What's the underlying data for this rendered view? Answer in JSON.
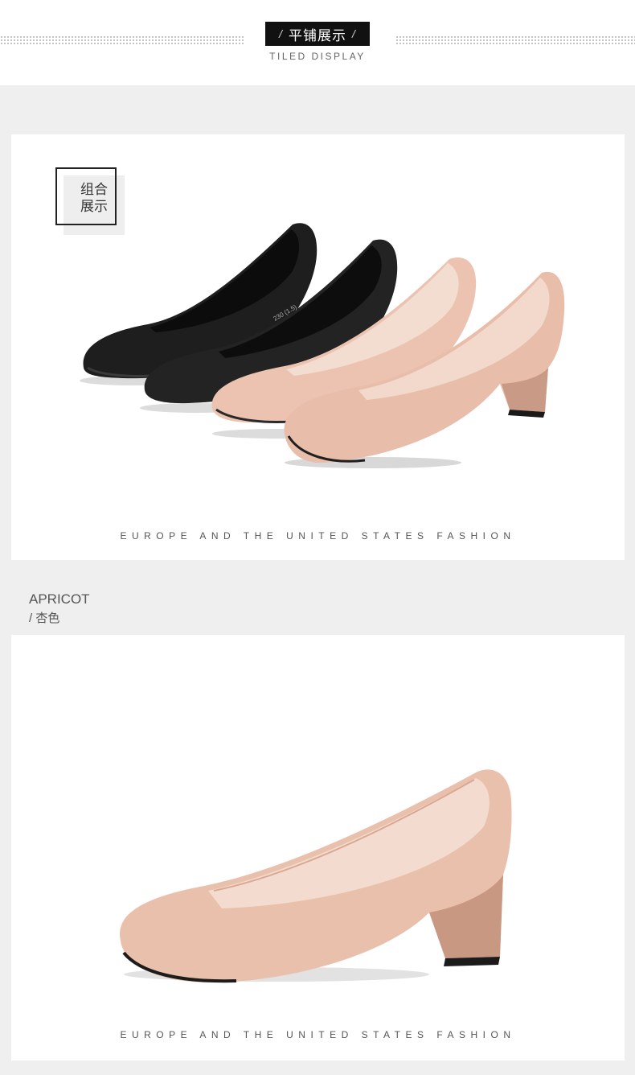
{
  "header": {
    "title": "平铺展示",
    "slash_left": "/",
    "slash_right": "/",
    "subtitle": "TILED DISPLAY"
  },
  "combo_panel": {
    "tag_line1": "组合",
    "tag_line2": "展示",
    "footer": "EUROPE AND THE UNITED STATES FASHION"
  },
  "color_section": {
    "name_en": "APRICOT",
    "name_cn": "/ 杏色"
  },
  "single_panel": {
    "footer": "EUROPE AND THE UNITED STATES FASHION"
  },
  "colors": {
    "black_shoe": "#1c1c1c",
    "apricot_shoe": "#e9c0ac",
    "apricot_dark": "#c99a86",
    "background": "#efefef"
  }
}
